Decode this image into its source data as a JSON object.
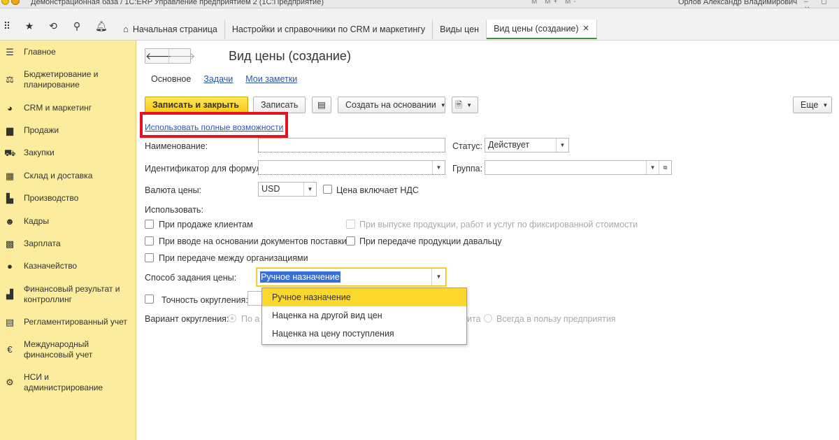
{
  "window": {
    "title": "Демонстрационная база / 1С:ERP Управление предприятием 2  (1С:Предприятие)",
    "toolbar_icons_text": "M  M+  M-",
    "user": "Орлов Александр Владимирович",
    "controls": "– ◻ ✕"
  },
  "toolbar": {
    "icons": [
      "grid-icon",
      "star-icon",
      "history-icon",
      "search-icon",
      "bell-icon"
    ]
  },
  "tabs": [
    {
      "label": "Начальная страница",
      "active": false
    },
    {
      "label": "Настройки и справочники по CRM и маркетингу",
      "active": false
    },
    {
      "label": "Виды цен",
      "active": false
    },
    {
      "label": "Вид цены (создание)",
      "active": true
    }
  ],
  "sidebar": {
    "items": [
      {
        "label": "Главное",
        "icon": "menu-icon"
      },
      {
        "label": "Бюджетирование и планирование",
        "icon": "budget-icon"
      },
      {
        "label": "CRM и маркетинг",
        "icon": "pie-chart-icon"
      },
      {
        "label": "Продажи",
        "icon": "bag-icon"
      },
      {
        "label": "Закупки",
        "icon": "cart-icon"
      },
      {
        "label": "Склад и доставка",
        "icon": "warehouse-icon"
      },
      {
        "label": "Производство",
        "icon": "factory-icon"
      },
      {
        "label": "Кадры",
        "icon": "people-icon"
      },
      {
        "label": "Зарплата",
        "icon": "calculator-icon"
      },
      {
        "label": "Казначейство",
        "icon": "coin-icon"
      },
      {
        "label": "Финансовый результат и контроллинг",
        "icon": "bar-chart-icon"
      },
      {
        "label": "Регламентированный учет",
        "icon": "ledger-icon"
      },
      {
        "label": "Международный финансовый учет",
        "icon": "currency-icon"
      },
      {
        "label": "НСИ и администрирование",
        "icon": "gear-icon"
      }
    ]
  },
  "form": {
    "title": "Вид цены (создание)",
    "subtabs": {
      "main": "Основное",
      "tasks": "Задачи",
      "notes": "Мои заметки"
    },
    "buttons": {
      "save_close": "Записать и закрыть",
      "save": "Записать",
      "create_based": "Создать на основании",
      "more": "Еще"
    },
    "full_features_link": "Использовать полные возможности",
    "fields": {
      "name_label": "Наименование:",
      "name_value": "",
      "status_label": "Статус:",
      "status_value": "Действует",
      "formula_id_label": "Идентификатор для формул:",
      "formula_id_value": "",
      "group_label": "Группа:",
      "group_value": "",
      "currency_label": "Валюта цены:",
      "currency_value": "USD",
      "vat_label": "Цена включает НДС",
      "use_label": "Использовать:",
      "use_sales": "При продаже клиентам",
      "use_fixed_cost": "При выпуске продукции, работ и услуг по фиксированной стоимости",
      "use_supply_docs": "При вводе на основании документов поставки",
      "use_processor": "При передаче продукции давальцу",
      "use_between_orgs": "При передаче между организациями",
      "price_method_label": "Способ задания цены:",
      "price_method_value": "Ручное назначение",
      "rounding_label": "Точность округления:",
      "rounding_variant_label": "Вариант округления:",
      "rounding_opt1": "По а",
      "rounding_opt2_tail": "ита",
      "rounding_opt3": "Всегда в пользу предприятия"
    },
    "dropdown_options": [
      "Ручное назначение",
      "Наценка на другой вид цен",
      "Наценка на цену поступления"
    ]
  }
}
